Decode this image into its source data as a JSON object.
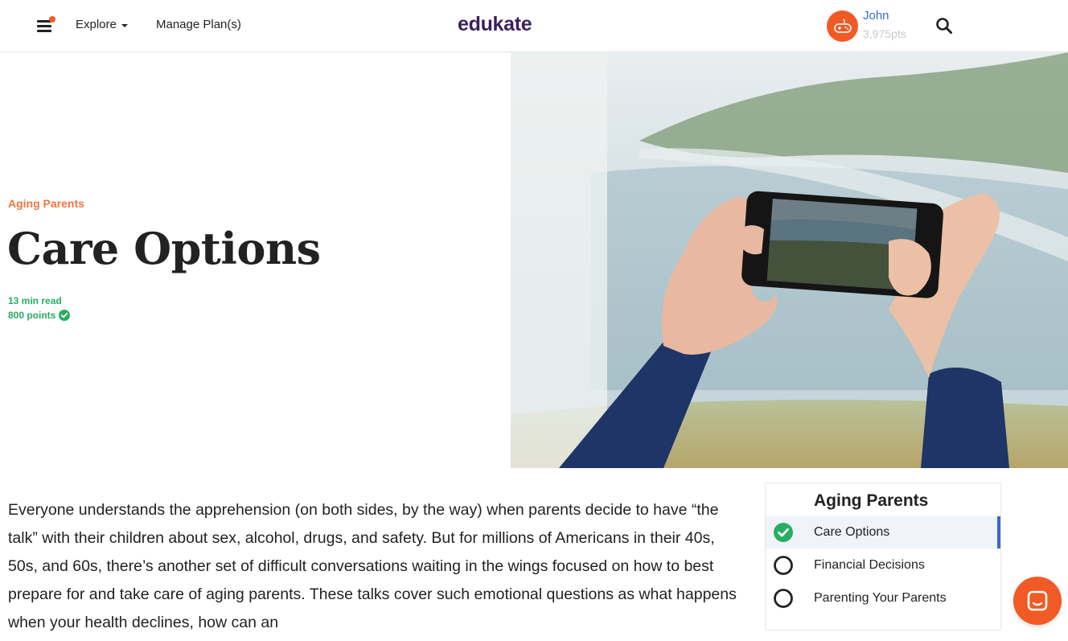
{
  "header": {
    "explore_label": "Explore",
    "plans_label": "Manage Plan(s)",
    "logo": "edukate",
    "user_name": "John",
    "user_points": "3,975pts"
  },
  "hero": {
    "category": "Aging Parents",
    "title": "Care Options",
    "read_time": "13 min read",
    "points": "800 points",
    "image_icon": "hands-holding-phone-photo"
  },
  "body": {
    "paragraph": "Everyone understands the apprehension (on both sides, by the way) when parents decide to have “the talk” with their children about sex, alcohol, drugs, and safety. But for millions of Americans in their 40s, 50s, and 60s, there’s another set of difficult conversations waiting in the wings focused on how to best prepare for and take care of aging parents. These talks cover such emotional questions as what happens when your health declines, how can an"
  },
  "sidebar": {
    "title": "Aging Parents",
    "items": [
      {
        "label": "Care Options",
        "status": "completed"
      },
      {
        "label": "Financial Decisions",
        "status": "not-started"
      },
      {
        "label": "Parenting Your Parents",
        "status": "not-started"
      }
    ]
  },
  "colors": {
    "accent_orange": "#f15a24",
    "category_orange": "#f0763f",
    "success_green": "#27ae60",
    "link_blue": "#3a6ac8",
    "logo_purple": "#3b1f5e"
  }
}
